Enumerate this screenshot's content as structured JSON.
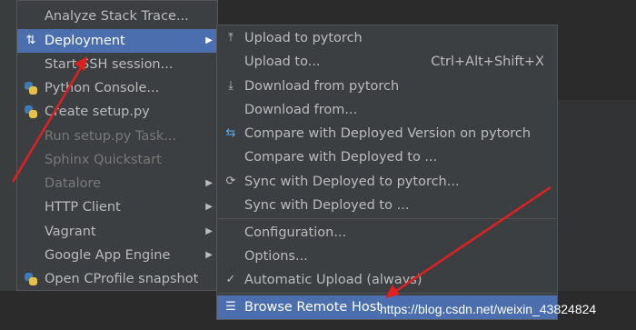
{
  "main_menu": {
    "items": [
      {
        "label": "Analyze Stack Trace...",
        "icon": "",
        "state": "normal",
        "submenu": false
      },
      {
        "label": "Deployment",
        "icon": "deployment-icon",
        "state": "selected",
        "submenu": true
      },
      {
        "label": "Start SSH session...",
        "icon": "",
        "state": "normal",
        "submenu": false
      },
      {
        "label": "Python Console...",
        "icon": "python-icon",
        "state": "normal",
        "submenu": false
      },
      {
        "label": "Create setup.py",
        "icon": "python-setup-icon",
        "state": "normal",
        "submenu": false
      },
      {
        "label": "Run setup.py Task...",
        "icon": "",
        "state": "disabled",
        "submenu": false
      },
      {
        "label": "Sphinx Quickstart",
        "icon": "",
        "state": "disabled",
        "submenu": false
      },
      {
        "label": "Datalore",
        "icon": "",
        "state": "disabled",
        "submenu": true
      },
      {
        "label": "HTTP Client",
        "icon": "",
        "state": "normal",
        "submenu": true
      },
      {
        "label": "Vagrant",
        "icon": "",
        "state": "normal",
        "submenu": true
      },
      {
        "label": "Google App Engine",
        "icon": "",
        "state": "normal",
        "submenu": true
      },
      {
        "label": "Open CProfile snapshot",
        "icon": "cprofile-icon",
        "state": "normal",
        "submenu": false
      }
    ]
  },
  "sub_menu": {
    "items": [
      {
        "label": "Upload to pytorch",
        "icon": "upload-icon",
        "shortcut": "",
        "state": "normal"
      },
      {
        "label": "Upload to...",
        "icon": "",
        "shortcut": "Ctrl+Alt+Shift+X",
        "state": "normal"
      },
      {
        "label": "Download from pytorch",
        "icon": "download-icon",
        "shortcut": "",
        "state": "normal"
      },
      {
        "label": "Download from...",
        "icon": "",
        "shortcut": "",
        "state": "normal"
      },
      {
        "label": "Compare with Deployed Version on pytorch",
        "icon": "compare-icon",
        "shortcut": "",
        "state": "normal"
      },
      {
        "label": "Compare with Deployed to ...",
        "icon": "",
        "shortcut": "",
        "state": "normal"
      },
      {
        "label": "Sync with Deployed to pytorch...",
        "icon": "sync-icon",
        "shortcut": "",
        "state": "normal"
      },
      {
        "label": "Sync with Deployed to ...",
        "icon": "",
        "shortcut": "",
        "state": "normal"
      },
      {
        "label": "Configuration...",
        "icon": "",
        "shortcut": "",
        "state": "normal"
      },
      {
        "label": "Options...",
        "icon": "",
        "shortcut": "",
        "state": "normal"
      },
      {
        "label": "Automatic Upload (always)",
        "icon": "check-icon",
        "shortcut": "",
        "state": "normal"
      },
      {
        "label": "Browse Remote Host",
        "icon": "browse-remote-host-icon",
        "shortcut": "",
        "state": "selected"
      }
    ]
  },
  "watermark": "https://blog.csdn.net/weixin_43824824",
  "colors": {
    "menu_bg": "#3c3f41",
    "selection": "#4b6eaf",
    "annotation_arrow": "#e02020"
  }
}
